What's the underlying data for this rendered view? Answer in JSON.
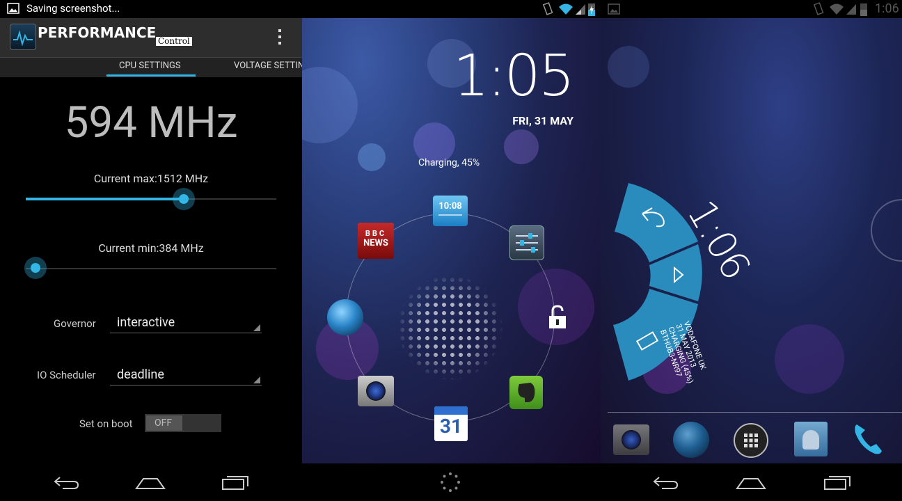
{
  "left_panel": {
    "status_text": "Saving screenshot...",
    "app_title": "PERFORMANCE",
    "app_subtitle": "Control",
    "tabs": [
      "CPU SETTINGS",
      "VOLTAGE SETTIN"
    ],
    "active_tab": "CPU SETTINGS",
    "frequency": "594 MHz",
    "max_label": "Current max:1512 MHz",
    "max_level_pct": 63,
    "min_label": "Current min:384 MHz",
    "min_level_pct": 4,
    "governor_label": "Governor",
    "governor_value": "interactive",
    "io_label": "IO Scheduler",
    "io_value": "deadline",
    "boot_label": "Set on boot",
    "boot_toggle": "OFF"
  },
  "middle_panel": {
    "time": "1:05",
    "date": "FRI, 31 MAY",
    "charging": "Charging, 45%",
    "notif_time": "10:08",
    "bbc_top": "BBC",
    "bbc_bottom": "NEWS",
    "calendar_day": "31",
    "icons": [
      "clock-icon",
      "settings-icon",
      "lock-icon",
      "evernote-icon",
      "calendar-icon",
      "camera-icon",
      "globe-icon",
      "bbc-news-icon"
    ]
  },
  "right_panel": {
    "status_time": "1:06",
    "clock_time": "1:06",
    "info_lines": [
      "VODAFONE UK",
      "31 MAY 2013",
      "CHARGING (45%)",
      "BTHUB3-NR97"
    ],
    "dock_icons": [
      "camera-icon",
      "globe-icon",
      "apps-drawer-icon",
      "contacts-icon",
      "phone-icon"
    ]
  },
  "colors": {
    "accent": "#33b5e5",
    "status_bar": "#000000",
    "action_bar": "#2d2d2d",
    "arc": "#2a8bbd"
  }
}
